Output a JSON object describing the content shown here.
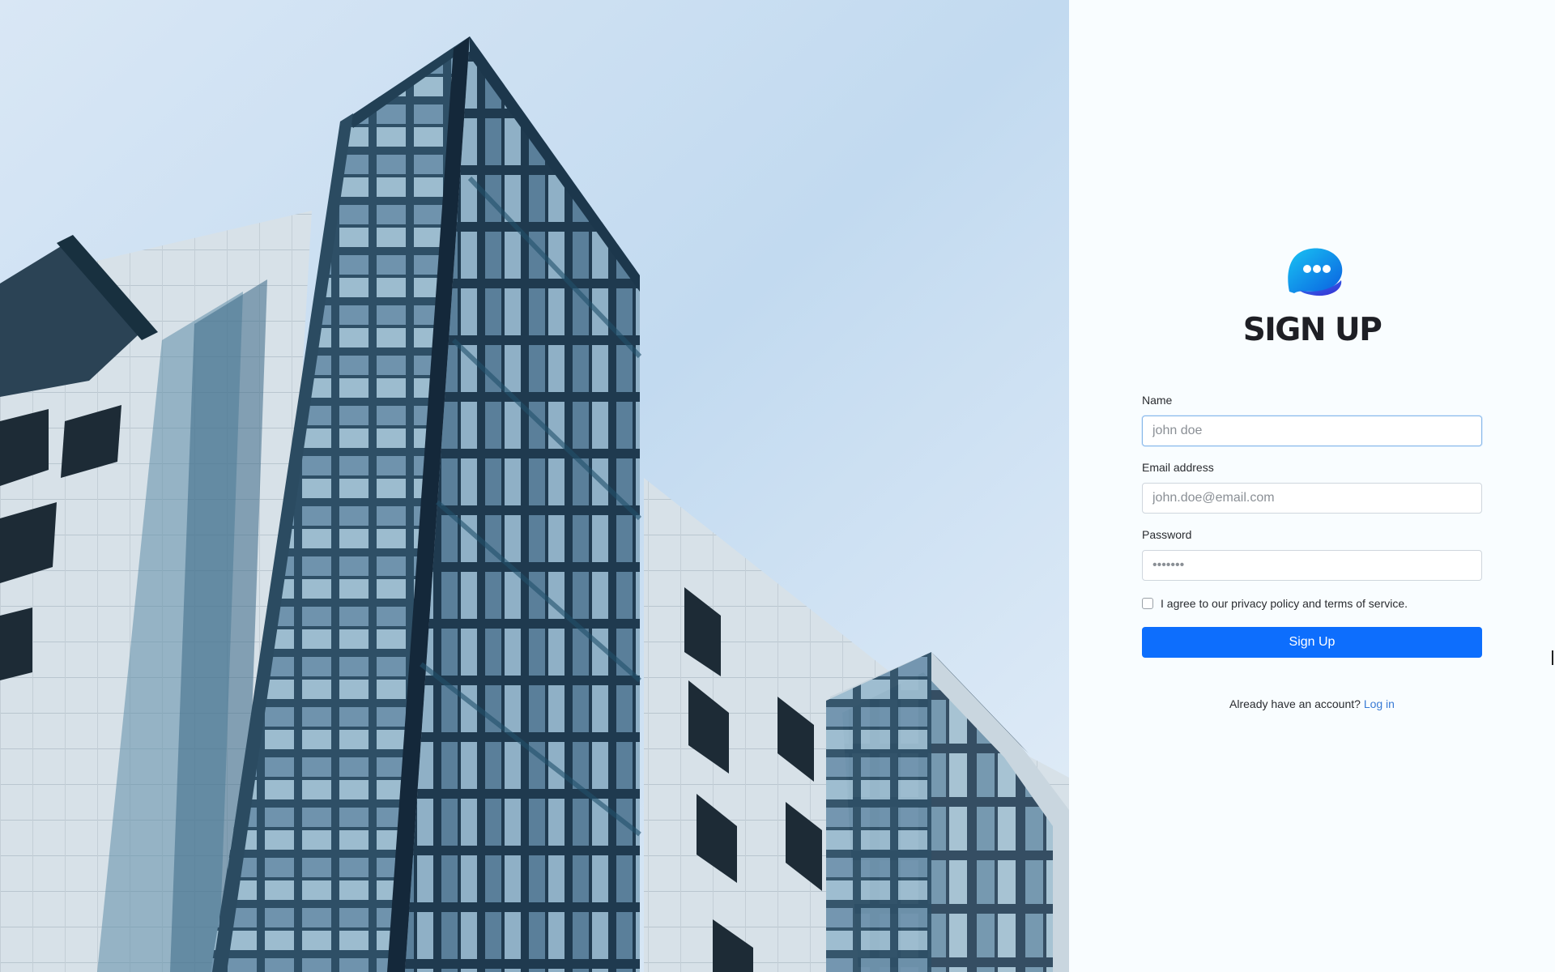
{
  "title": "SIGN UP",
  "form": {
    "name": {
      "label": "Name",
      "placeholder": "john doe"
    },
    "email": {
      "label": "Email address",
      "placeholder": "john.doe@email.com"
    },
    "password": {
      "label": "Password",
      "placeholder": "•••••••"
    },
    "agree_text": "I agree to our privacy policy and terms of service.",
    "submit_label": "Sign Up"
  },
  "footer": {
    "prompt": "Already have an account?",
    "login_label": "Log in"
  },
  "icons": {
    "logo": "chat-bubble-icon"
  },
  "colors": {
    "accent": "#0d6efd",
    "link": "#3a7bd5",
    "panel_bg": "#f9fdff",
    "title": "#1e1f25"
  }
}
